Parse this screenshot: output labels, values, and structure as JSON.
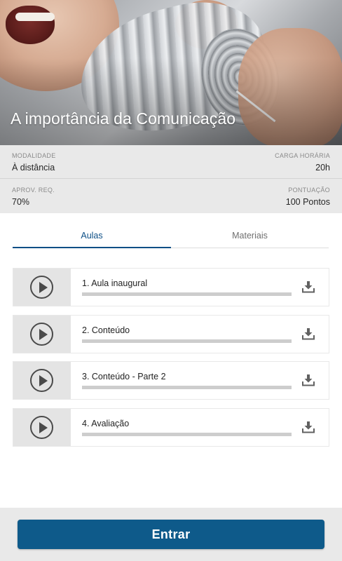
{
  "hero": {
    "title": "A importância da Comunicação",
    "image": "tin-can-telephone-photo"
  },
  "info": {
    "modalidade_label": "MODALIDADE",
    "modalidade_value": "À distância",
    "carga_label": "CARGA HORÁRIA",
    "carga_value": "20h",
    "aprov_label": "APROV. REQ.",
    "aprov_value": "70%",
    "pontuacao_label": "PONTUAÇÃO",
    "pontuacao_value": "100 Pontos"
  },
  "tabs": [
    {
      "label": "Aulas",
      "active": true
    },
    {
      "label": "Materiais",
      "active": false
    }
  ],
  "lessons": [
    {
      "title": "1. Aula inaugural",
      "progress": 0,
      "icon": "play-icon",
      "action_icon": "download-icon"
    },
    {
      "title": "2. Conteúdo",
      "progress": 0,
      "icon": "play-icon",
      "action_icon": "download-icon"
    },
    {
      "title": "3. Conteúdo - Parte 2",
      "progress": 0,
      "icon": "play-icon",
      "action_icon": "download-icon"
    },
    {
      "title": "4. Avaliação",
      "progress": 0,
      "icon": "play-icon",
      "action_icon": "download-icon"
    }
  ],
  "footer": {
    "enter_label": "Entrar"
  },
  "colors": {
    "accent": "#0d4f86",
    "button": "#0e5a8a",
    "info_bg": "#e9e9e9"
  }
}
